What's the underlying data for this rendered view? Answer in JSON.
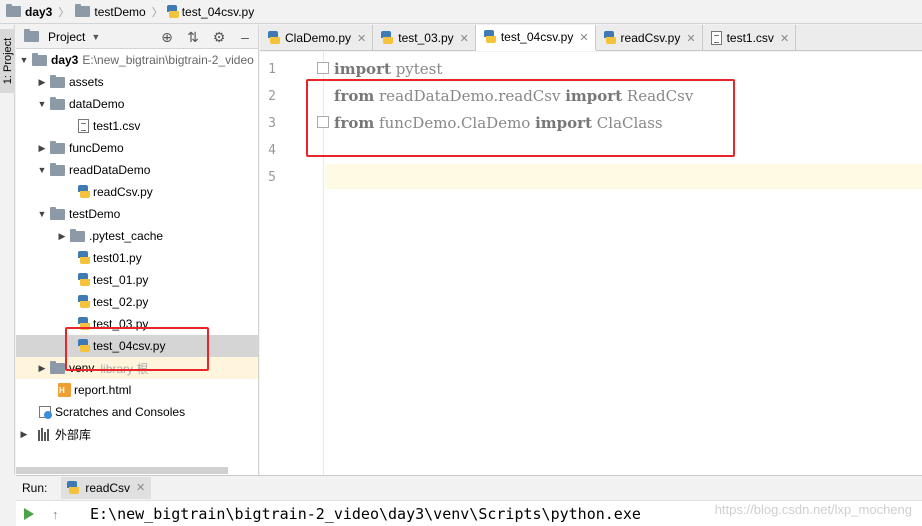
{
  "breadcrumb": [
    {
      "label": "day3",
      "icon": "folder-icon"
    },
    {
      "label": "testDemo",
      "icon": "folder-icon"
    },
    {
      "label": "test_04csv.py",
      "icon": "python-file-icon"
    }
  ],
  "sidestrip": {
    "project_tab": "1: Project"
  },
  "project_panel": {
    "title": "Project",
    "tools": [
      "locate-icon",
      "collapse-icon",
      "gear-icon",
      "hide-icon"
    ],
    "tree": [
      {
        "label": "day3",
        "path": "E:\\new_bigtrain\\bigtrain-2_video",
        "type": "folder",
        "depth": 0,
        "expanded": true
      },
      {
        "label": "assets",
        "type": "folder",
        "depth": 1,
        "expanded": false
      },
      {
        "label": "dataDemo",
        "type": "folder",
        "depth": 1,
        "expanded": true
      },
      {
        "label": "test1.csv",
        "type": "csv",
        "depth": 2
      },
      {
        "label": "funcDemo",
        "type": "folder",
        "depth": 1,
        "expanded": false
      },
      {
        "label": "readDataDemo",
        "type": "folder",
        "depth": 1,
        "expanded": true
      },
      {
        "label": "readCsv.py",
        "type": "py",
        "depth": 2
      },
      {
        "label": "testDemo",
        "type": "folder",
        "depth": 1,
        "expanded": true
      },
      {
        "label": ".pytest_cache",
        "type": "folder",
        "depth": 2,
        "expanded": false
      },
      {
        "label": "test01.py",
        "type": "py",
        "depth": 2
      },
      {
        "label": "test_01.py",
        "type": "py",
        "depth": 2
      },
      {
        "label": "test_02.py",
        "type": "py",
        "depth": 2
      },
      {
        "label": "test_03.py",
        "type": "py",
        "depth": 2
      },
      {
        "label": "test_04csv.py",
        "type": "py",
        "depth": 2,
        "selected": true
      },
      {
        "label": "venv",
        "tag": "library 根",
        "type": "folder",
        "depth": 1,
        "expanded": false
      },
      {
        "label": "report.html",
        "type": "html",
        "depth": 1
      },
      {
        "label": "Scratches and Consoles",
        "type": "scratch",
        "depth": 0
      },
      {
        "label": "外部库",
        "type": "libs",
        "depth": 0,
        "expanded": false
      }
    ]
  },
  "tabs": [
    {
      "label": "ClaDemo.py",
      "icon": "python-file-icon",
      "active": false
    },
    {
      "label": "test_03.py",
      "icon": "python-file-icon",
      "active": false
    },
    {
      "label": "test_04csv.py",
      "icon": "python-file-icon",
      "active": true
    },
    {
      "label": "readCsv.py",
      "icon": "python-file-icon",
      "active": false
    },
    {
      "label": "test1.csv",
      "icon": "csv-file-icon",
      "active": false
    }
  ],
  "editor": {
    "line_numbers": [
      "1",
      "2",
      "3",
      "4",
      "5"
    ],
    "lines": [
      {
        "kw1": "import",
        "mod": "pytest",
        "kw2": "",
        "name": ""
      },
      {
        "kw1": "from",
        "mod": "readDataDemo.readCsv",
        "kw2": "import",
        "name": "ReadCsv"
      },
      {
        "kw1": "from",
        "mod": "funcDemo.ClaDemo",
        "kw2": "import",
        "name": "ClaClass"
      },
      {
        "kw1": "",
        "mod": "",
        "kw2": "",
        "name": ""
      },
      {
        "kw1": "",
        "mod": "",
        "kw2": "",
        "name": ""
      }
    ],
    "current_line": 5
  },
  "run_panel": {
    "label": "Run:",
    "tab": "readCsv",
    "command": "E:\\new_bigtrain\\bigtrain-2_video\\day3\\venv\\Scripts\\python.exe",
    "watermark": "https://blog.csdn.net/lxp_mocheng"
  },
  "colors": {
    "highlight_box": "#e8262a",
    "keyword": "#000080",
    "selection": "#d5d5d5",
    "current_line": "#fffae3"
  }
}
